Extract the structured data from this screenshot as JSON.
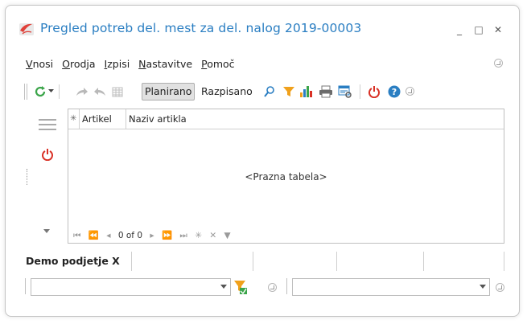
{
  "window": {
    "title": "Pregled potreb del. mest za del. nalog 2019-00003",
    "minimize_glyph": "_",
    "maximize_glyph": "□",
    "close_glyph": "✕"
  },
  "menu": {
    "items": [
      "Vnosi",
      "Orodja",
      "Izpisi",
      "Nastavitve",
      "Pomoč"
    ]
  },
  "toolbar": {
    "planirano_label": "Planirano",
    "razpisano_label": "Razpisano",
    "icons": [
      "refresh-icon",
      "forward-icon",
      "back-icon",
      "grid-icon",
      "search-icon",
      "filter-icon",
      "chart-icon",
      "print-icon",
      "export-icon",
      "power-icon",
      "help-icon"
    ]
  },
  "grid": {
    "columns": [
      "Artikel",
      "Naziv artikla"
    ],
    "empty_text": "<Prazna tabela>",
    "record_count": "0 of 0"
  },
  "bottom": {
    "company_label": "Demo podjetje X",
    "company_select_value": "",
    "second_select_value": ""
  },
  "colors": {
    "title_blue": "#2a7ec2",
    "refresh_green": "#3ba54a",
    "filter_orange": "#f0a11c",
    "power_red": "#d93025",
    "help_blue": "#2a7ec2"
  }
}
